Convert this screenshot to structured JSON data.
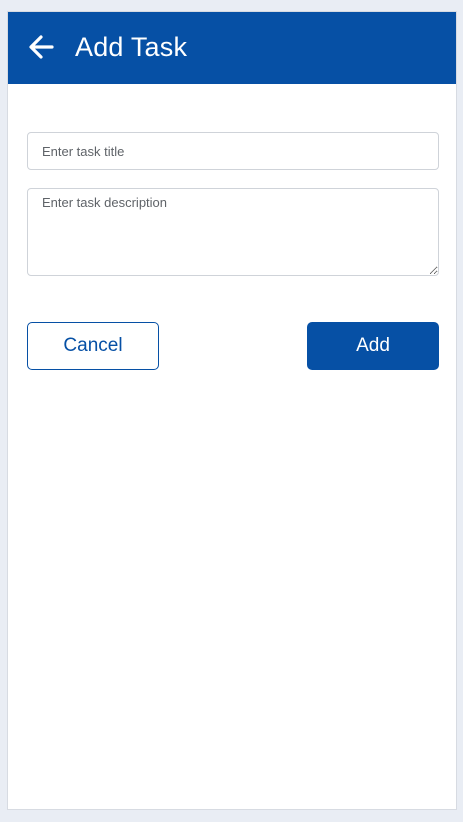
{
  "header": {
    "title": "Add Task",
    "back_icon": "arrow-left-icon"
  },
  "form": {
    "title_placeholder": "Enter task title",
    "title_value": "",
    "description_placeholder": "Enter task description",
    "description_value": ""
  },
  "actions": {
    "cancel_label": "Cancel",
    "add_label": "Add"
  },
  "colors": {
    "primary": "#0650a5",
    "background": "#e9edf4",
    "surface": "#ffffff"
  }
}
